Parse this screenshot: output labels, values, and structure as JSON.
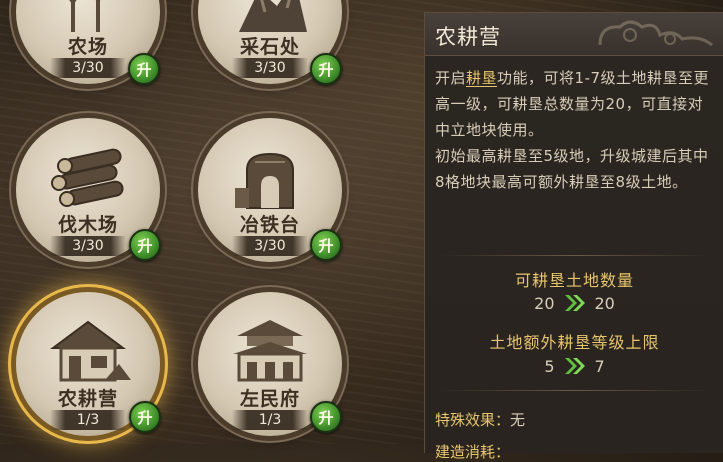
{
  "buildings": [
    {
      "name": "农场",
      "count": "3/30",
      "upgrade": "升",
      "icon": "farm-icon"
    },
    {
      "name": "采石处",
      "count": "3/30",
      "upgrade": "升",
      "icon": "quarry-icon"
    },
    {
      "name": "伐木场",
      "count": "3/30",
      "upgrade": "升",
      "icon": "logs-icon"
    },
    {
      "name": "冶铁台",
      "count": "3/30",
      "upgrade": "升",
      "icon": "furnace-icon"
    },
    {
      "name": "农耕营",
      "count": "1/3",
      "upgrade": "升",
      "icon": "camp-icon",
      "selected": true
    },
    {
      "name": "左民府",
      "count": "1/3",
      "upgrade": "升",
      "icon": "mansion-icon"
    }
  ],
  "panel": {
    "title": "农耕营",
    "desc_pre": "开启",
    "desc_highlight": "耕垦",
    "desc_post": "功能，可将1-7级土地耕垦至更高一级，可耕垦总数量为20，可直接对中立地块使用。",
    "desc_line2": "初始最高耕垦至5级地，升级城建后其中8格地块最高可额外耕垦至8级土地。",
    "stat1": {
      "label": "可耕垦土地数量",
      "from": "20",
      "to": "20"
    },
    "stat2": {
      "label": "土地额外耕垦等级上限",
      "from": "5",
      "to": "7"
    },
    "special_label": "特殊效果：",
    "special_value": "无",
    "cutoff_label": "建造消耗："
  },
  "colors": {
    "accent_gold": "#e6c56c",
    "upgrade_green": "#3f8e2a",
    "selected_glow": "#e8b94a"
  }
}
